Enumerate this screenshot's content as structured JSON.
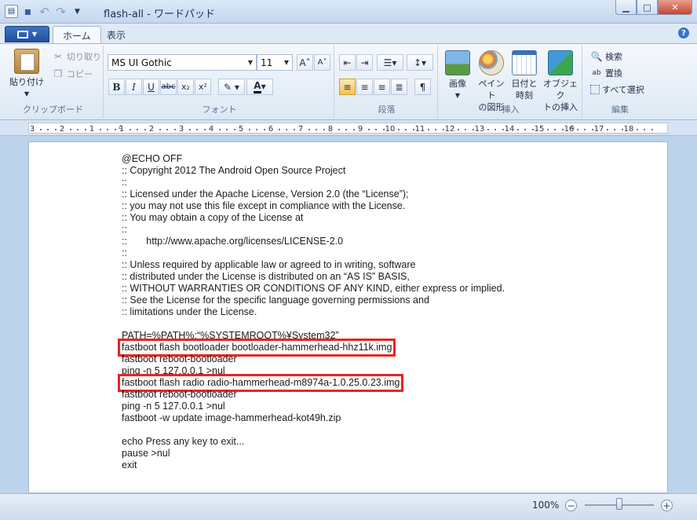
{
  "window": {
    "title": "flash-all - ワードパッド"
  },
  "tabs": [
    {
      "label": "ホーム",
      "active": true
    },
    {
      "label": "表示",
      "active": false
    }
  ],
  "ribbon": {
    "clipboard": {
      "label": "クリップボード",
      "paste": "貼り付け",
      "cut": "切り取り",
      "copy": "コピー"
    },
    "font": {
      "label": "フォント",
      "family": "MS UI Gothic",
      "size": "11"
    },
    "paragraph": {
      "label": "段落"
    },
    "insert": {
      "label": "挿入",
      "picture": "画像",
      "paint_line1": "ペイント",
      "paint_line2": "の図形",
      "datetime_line1": "日付と",
      "datetime_line2": "時刻",
      "object_line1": "オブジェク",
      "object_line2": "トの挿入"
    },
    "editing": {
      "label": "編集",
      "find": "検索",
      "replace": "置換",
      "select_all": "すべて選択"
    }
  },
  "ruler": {
    "marks": [
      "3",
      "2",
      "1",
      "1",
      "2",
      "3",
      "4",
      "5",
      "6",
      "7",
      "8",
      "9",
      "10",
      "11",
      "12",
      "13",
      "14",
      "15",
      "16",
      "17",
      "18"
    ]
  },
  "document": {
    "lines": [
      "@ECHO OFF",
      ":: Copyright 2012 The Android Open Source Project",
      "::",
      ":: Licensed under the Apache License, Version 2.0 (the “License”);",
      ":: you may not use this file except in compliance with the License.",
      ":: You may obtain a copy of the License at",
      "::",
      "::       http://www.apache.org/licenses/LICENSE-2.0",
      "::",
      ":: Unless required by applicable law or agreed to in writing, software",
      ":: distributed under the License is distributed on an “AS IS” BASIS,",
      ":: WITHOUT WARRANTIES OR CONDITIONS OF ANY KIND, either express or implied.",
      ":: See the License for the specific language governing permissions and",
      ":: limitations under the License.",
      "",
      "PATH=%PATH%;“%SYSTEMROOT%¥System32”",
      "fastboot flash bootloader bootloader-hammerhead-hhz11k.img",
      "fastboot reboot-bootloader",
      "ping -n 5 127.0.0.1 >nul",
      "fastboot flash radio radio-hammerhead-m8974a-1.0.25.0.23.img",
      "fastboot reboot-bootloader",
      "ping -n 5 127.0.0.1 >nul",
      "fastboot -w update image-hammerhead-kot49h.zip",
      "",
      "echo Press any key to exit...",
      "pause >nul",
      "exit"
    ]
  },
  "status": {
    "zoom": "100%",
    "zoom_percent": 100
  }
}
